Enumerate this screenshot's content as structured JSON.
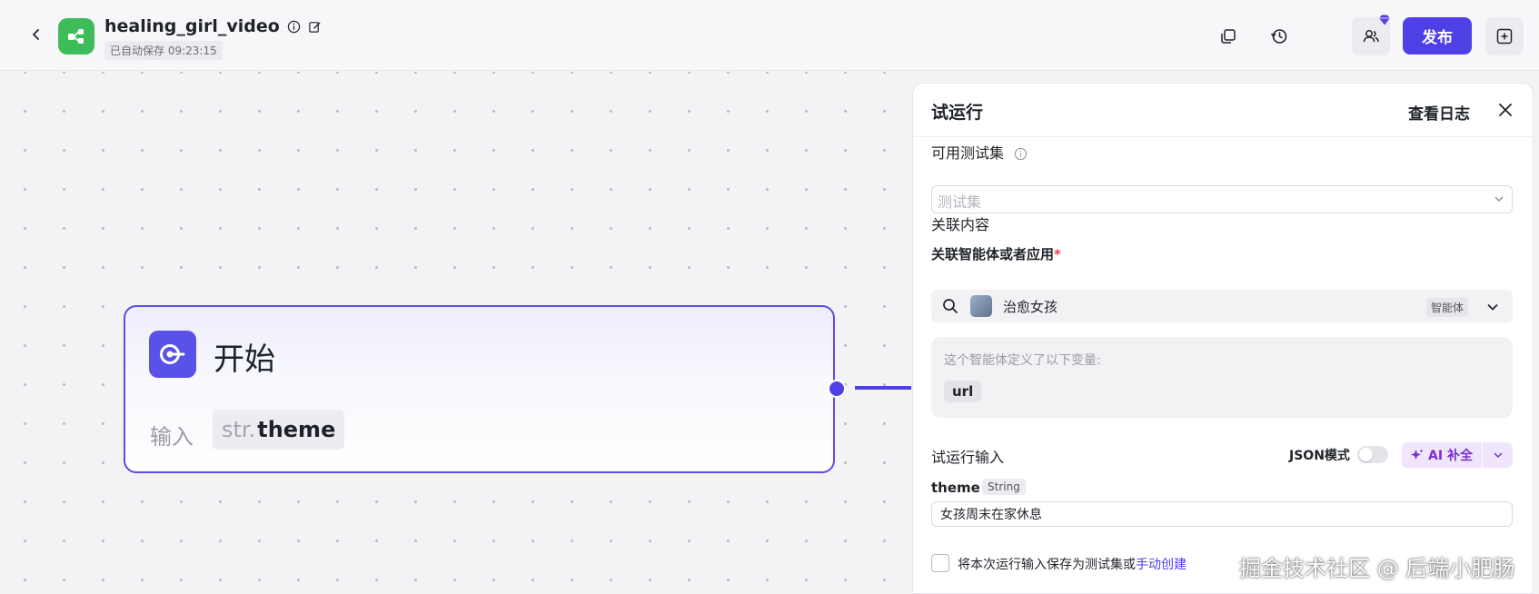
{
  "header": {
    "title": "healing_girl_video",
    "autosave": "已自动保存 09:23:15",
    "publish_label": "发布",
    "icons": [
      "back-arrow-icon",
      "workflow-icon",
      "info-icon",
      "edit-icon",
      "duplicate-icon",
      "history-icon",
      "collaborators-icon",
      "add-panel-icon"
    ]
  },
  "node": {
    "title": "开始",
    "input_label": "输入",
    "var_type": "str.",
    "var_name": "theme"
  },
  "panel": {
    "title": "试运行",
    "view_log": "查看日志",
    "testset_label": "可用测试集",
    "testset_placeholder": "测试集",
    "related_label": "关联内容",
    "agent_label": "关联智能体或者应用",
    "required_mark": "*",
    "agent_name": "治愈女孩",
    "agent_tag": "智能体",
    "vars_desc": "这个智能体定义了以下变量:",
    "vars": [
      "url"
    ],
    "run_input_label": "试运行输入",
    "json_mode_label": "JSON模式",
    "json_mode_on": false,
    "ai_fill_label": "AI 补全",
    "param_name": "theme",
    "param_type": "String",
    "param_value": "女孩周末在家休息",
    "save_text": "将本次运行输入保存为测试集或",
    "save_link": "手动创建"
  },
  "watermark": "掘金技术社区 @ 后端小肥肠",
  "colors": {
    "accent": "#4e40e5",
    "app_icon": "#3fbc5a",
    "ai_purple": "#7a2ed1"
  }
}
